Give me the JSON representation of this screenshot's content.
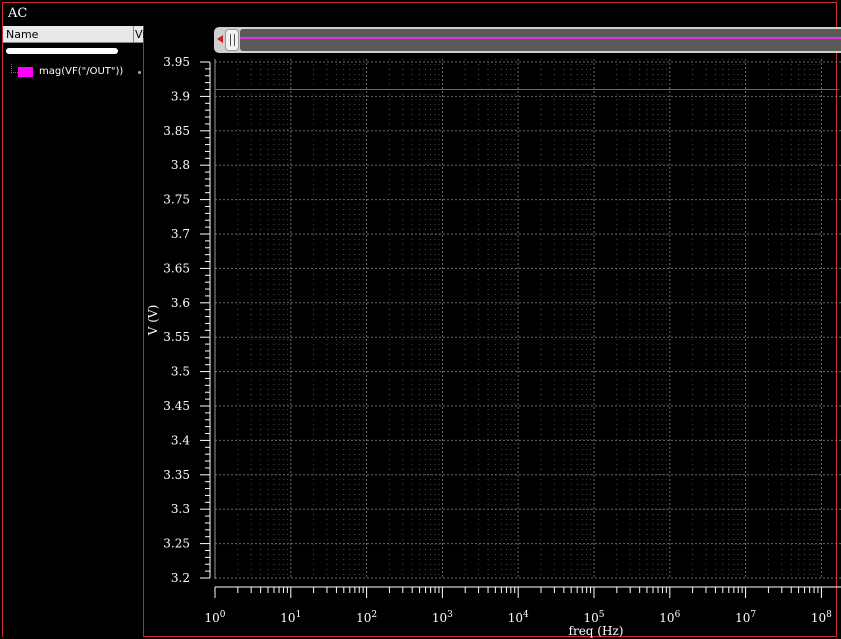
{
  "window": {
    "title": "AC"
  },
  "browser": {
    "columns": [
      "Name",
      "Vi"
    ],
    "legend": [
      {
        "label": "mag(VF(\"/OUT\"))",
        "color": "#ff00ff"
      }
    ]
  },
  "colors": {
    "grid": "#6a6a6a",
    "axis": "#ffffff",
    "trace": "#ff00ff",
    "zoom_trace": "#d23cd2"
  },
  "icons": {
    "zoom_left": "left-arrow-icon",
    "zoom_handle": "grip-icon"
  },
  "chart_data": {
    "type": "line",
    "title": "AC",
    "xlabel": "freq (Hz)",
    "ylabel": "V (V)",
    "xscale": "log",
    "xlim": [
      1,
      170000000.0
    ],
    "ylim": [
      3.2,
      3.95
    ],
    "grid": true,
    "legend": "left-panel",
    "yticks": [
      "3.2",
      "3.25",
      "3.3",
      "3.35",
      "3.4",
      "3.45",
      "3.5",
      "3.55",
      "3.6",
      "3.65",
      "3.7",
      "3.75",
      "3.8",
      "3.85",
      "3.9",
      "3.95"
    ],
    "xticks": [
      {
        "base": "10",
        "exp": "0"
      },
      {
        "base": "10",
        "exp": "1"
      },
      {
        "base": "10",
        "exp": "2"
      },
      {
        "base": "10",
        "exp": "3"
      },
      {
        "base": "10",
        "exp": "4"
      },
      {
        "base": "10",
        "exp": "5"
      },
      {
        "base": "10",
        "exp": "6"
      },
      {
        "base": "10",
        "exp": "7"
      },
      {
        "base": "10",
        "exp": "8"
      }
    ],
    "series": [
      {
        "name": "mag(VF(\"/OUT\"))",
        "color": "#ff00ff",
        "x": [
          1,
          170000000.0
        ],
        "y": [
          3.91,
          3.91
        ]
      }
    ]
  }
}
